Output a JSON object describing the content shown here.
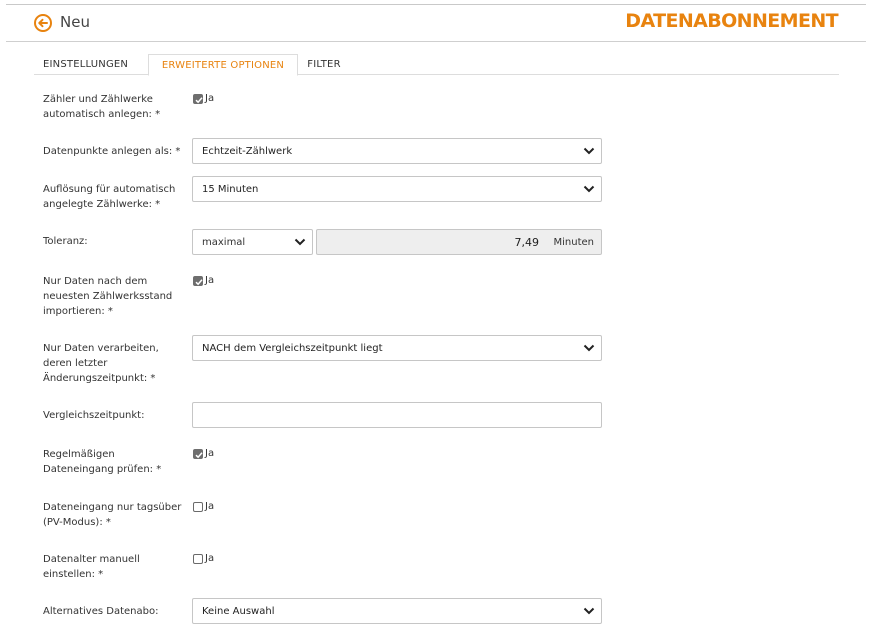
{
  "header": {
    "title": "Neu",
    "brand": "DATENABONNEMENT",
    "accent_color": "#e8830f",
    "back_icon": "back-arrow-circle-icon"
  },
  "tabs": [
    {
      "label": "EINSTELLUNGEN",
      "active": false
    },
    {
      "label": "ERWEITERTE OPTIONEN",
      "active": true
    },
    {
      "label": "FILTER",
      "active": false
    }
  ],
  "form": {
    "auto_counters": {
      "label_line1": "Zähler und Zählwerke",
      "label_line2": "automatisch anlegen: *",
      "checkbox_label": "Ja",
      "checked": true
    },
    "datapoints_as": {
      "label": "Datenpunkte anlegen als: *",
      "value": "Echtzeit-Zählwerk"
    },
    "resolution": {
      "label_line1": "Auflösung für automatisch",
      "label_line2": "angelegte Zählwerke: *",
      "value": "15 Minuten"
    },
    "tolerance": {
      "label": "Toleranz:",
      "mode": "maximal",
      "value": "7,49",
      "unit": "Minuten"
    },
    "only_newer": {
      "label_line1": "Nur Daten nach dem",
      "label_line2": "neuesten Zählwerksstand",
      "label_line3": "importieren: *",
      "checkbox_label": "Ja",
      "checked": true
    },
    "process_only": {
      "label_line1": "Nur Daten verarbeiten,",
      "label_line2": "deren letzter",
      "label_line3": "Änderungszeitpunkt: *",
      "value": "NACH dem Vergleichszeitpunkt liegt"
    },
    "compare_time": {
      "label": "Vergleichszeitpunkt:",
      "value": ""
    },
    "check_regular": {
      "label_line1": "Regelmäßigen",
      "label_line2": "Dateneingang prüfen: *",
      "checkbox_label": "Ja",
      "checked": true
    },
    "daytime_only": {
      "label_line1": "Dateneingang nur tagsüber",
      "label_line2": "(PV-Modus): *",
      "checkbox_label": "Ja",
      "checked": false
    },
    "data_age": {
      "label_line1": "Datenalter manuell",
      "label_line2": "einstellen: *",
      "checkbox_label": "Ja",
      "checked": false
    },
    "alt_subscription": {
      "label": "Alternatives Datenabo:",
      "value": "Keine Auswahl"
    }
  }
}
